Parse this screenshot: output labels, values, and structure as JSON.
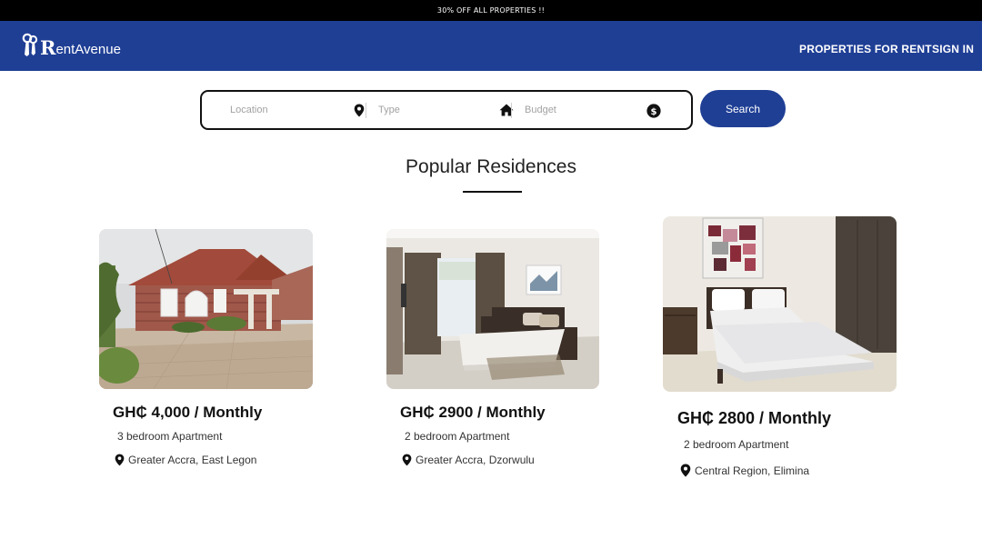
{
  "promo": {
    "text": "30% OFF ALL PROPERTIES !!"
  },
  "nav": {
    "logo_initial": "R",
    "logo_rest": "entAvenue",
    "links": [
      "PROPERTIES FOR RENT",
      "SIGN IN"
    ]
  },
  "search": {
    "location_placeholder": "Location",
    "type_placeholder": "Type",
    "budget_placeholder": "Budget",
    "button_label": "Search",
    "icons": [
      "location-pin-icon",
      "home-icon",
      "dollar-icon"
    ]
  },
  "section": {
    "title": "Popular Residences"
  },
  "listings": [
    {
      "price": "GH₵ 4,000 / Monthly",
      "type": "3 bedroom Apartment",
      "location": "Greater Accra, East Legon",
      "image": "house-exterior"
    },
    {
      "price": "GH₵ 2900 / Monthly",
      "type": "2 bedroom Apartment",
      "location": "Greater Accra, Dzorwulu",
      "image": "bedroom"
    },
    {
      "price": "GH₵ 2800 / Monthly",
      "type": "2 bedroom Apartment",
      "location": "Central Region, Elimina",
      "image": "bedroom"
    }
  ],
  "colors": {
    "brand": "#1f3f95",
    "promo_bg": "#000000",
    "text": "#111111"
  }
}
